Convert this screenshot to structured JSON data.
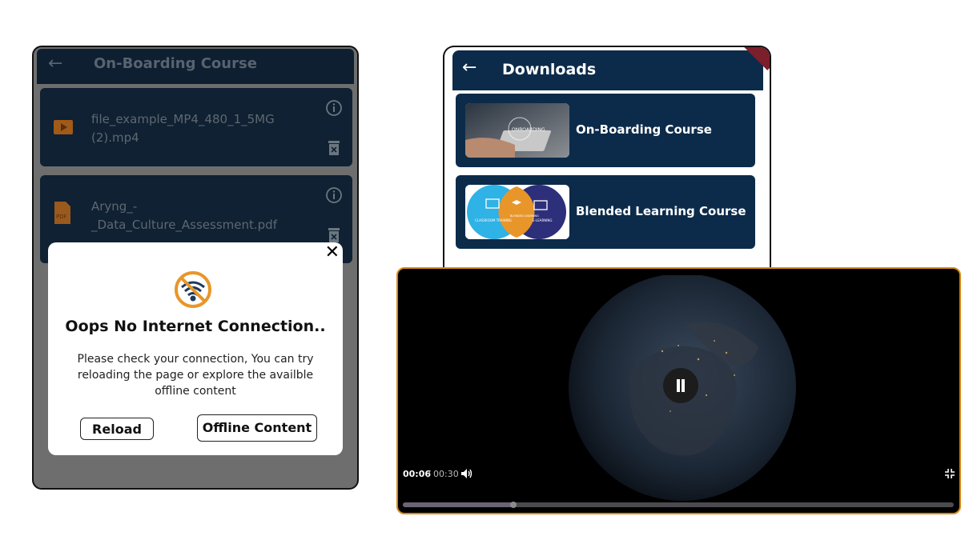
{
  "offline_screen": {
    "header": {
      "title": "On-Boarding Course"
    },
    "downloads": [
      {
        "file_name": "file_example_MP4_480_1_5MG (2).mp4",
        "type_icon": "video-file-icon"
      },
      {
        "file_name": "Aryng_-_Data_Culture_Assessment.pdf",
        "type_icon": "pdf-file-icon",
        "type_label": "PDF"
      }
    ],
    "dialog": {
      "icon": "no-wifi-icon",
      "title": "Oops No Internet Connection..",
      "message": "Please check your connection, You can try reloading the page or explore the availble offline content",
      "reload_label": "Reload",
      "offline_label": "Offline Content",
      "close_glyph": "✕"
    }
  },
  "downloads_screen": {
    "header": {
      "title": "Downloads"
    },
    "courses": [
      {
        "name": "On-Boarding Course",
        "thumb_text": "ONBOARDING"
      },
      {
        "name": "Blended Learning Course",
        "thumb_labels": [
          "CLASSROOM TRAINING",
          "BLENDED LEARNING",
          "E-LEARNING"
        ]
      }
    ]
  },
  "video_player": {
    "current_time": "00:06",
    "separator": "/",
    "duration": "00:30",
    "progress_fraction": 0.2,
    "state": "playing",
    "controls": [
      "pause-icon",
      "volume-icon",
      "exit-fullscreen-icon"
    ]
  },
  "colors": {
    "header_navy": "#0c2b4a",
    "dimmed_card": "#0f2132",
    "accent_orange": "#e8962a",
    "video_border": "#d88a1b"
  }
}
